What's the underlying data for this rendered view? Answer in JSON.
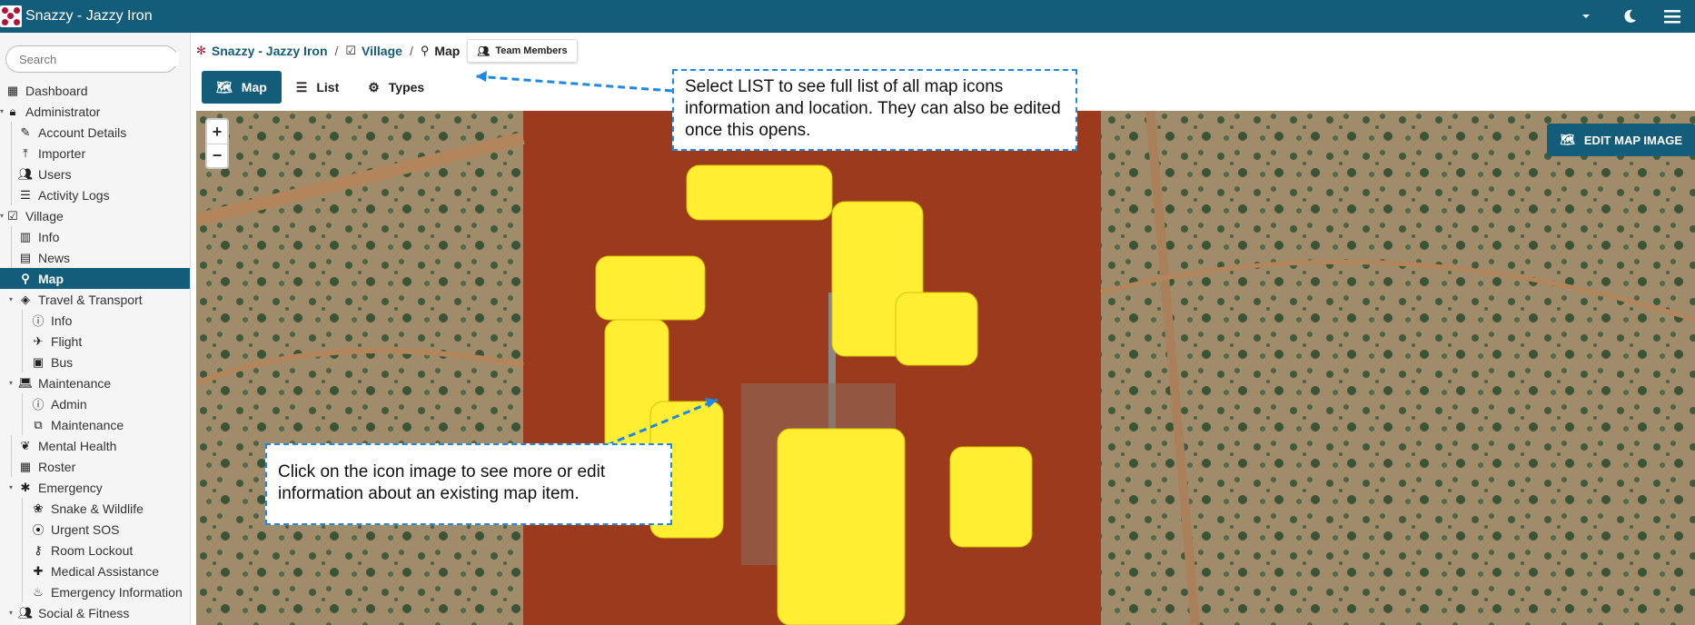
{
  "app": {
    "title": "Snazzy - Jazzy Iron"
  },
  "search": {
    "placeholder": "Search"
  },
  "sidebar": {
    "items": [
      {
        "label": "Dashboard",
        "icon": "dashboard-icon"
      },
      {
        "label": "Administrator",
        "icon": "lock-icon"
      },
      {
        "label": "Account Details",
        "icon": "pencil-icon"
      },
      {
        "label": "Importer",
        "icon": "upload-icon"
      },
      {
        "label": "Users",
        "icon": "users-icon"
      },
      {
        "label": "Activity Logs",
        "icon": "list-icon"
      },
      {
        "label": "Village",
        "icon": "checklist-icon"
      },
      {
        "label": "Info",
        "icon": "buildings-icon"
      },
      {
        "label": "News",
        "icon": "newspaper-icon"
      },
      {
        "label": "Map",
        "icon": "map-pin-icon"
      },
      {
        "label": "Travel & Transport",
        "icon": "directions-icon"
      },
      {
        "label": "Info",
        "icon": "info-icon"
      },
      {
        "label": "Flight",
        "icon": "plane-icon"
      },
      {
        "label": "Bus",
        "icon": "bus-icon"
      },
      {
        "label": "Maintenance",
        "icon": "laptop-icon"
      },
      {
        "label": "Admin",
        "icon": "info-icon"
      },
      {
        "label": "Maintenance",
        "icon": "toolbox-icon"
      },
      {
        "label": "Mental Health",
        "icon": "hands-icon"
      },
      {
        "label": "Roster",
        "icon": "calendar-icon"
      },
      {
        "label": "Emergency",
        "icon": "asterisk-icon"
      },
      {
        "label": "Snake & Wildlife",
        "icon": "paw-icon"
      },
      {
        "label": "Urgent SOS",
        "icon": "signal-icon"
      },
      {
        "label": "Room Lockout",
        "icon": "key-icon"
      },
      {
        "label": "Medical Assistance",
        "icon": "medkit-icon"
      },
      {
        "label": "Emergency Information",
        "icon": "fire-icon"
      },
      {
        "label": "Social & Fitness",
        "icon": "people-icon"
      }
    ]
  },
  "breadcrumb": {
    "root": "Snazzy - Jazzy Iron",
    "village": "Village",
    "current": "Map",
    "team_button": "Team Members"
  },
  "tabs": {
    "map": "Map",
    "list": "List",
    "types": "Types"
  },
  "map": {
    "edit_button": "EDIT MAP IMAGE",
    "zoom_in": "+",
    "zoom_out": "−"
  },
  "callouts": {
    "list": "Select LIST to see full list of all map icons information and location. They can also be edited once this opens.",
    "icon": "Click on the icon image to see more or edit information about an existing map item."
  },
  "colors": {
    "brand": "#135d7a",
    "callout_border": "#1e88e5",
    "accommodation": "#ffee32"
  }
}
